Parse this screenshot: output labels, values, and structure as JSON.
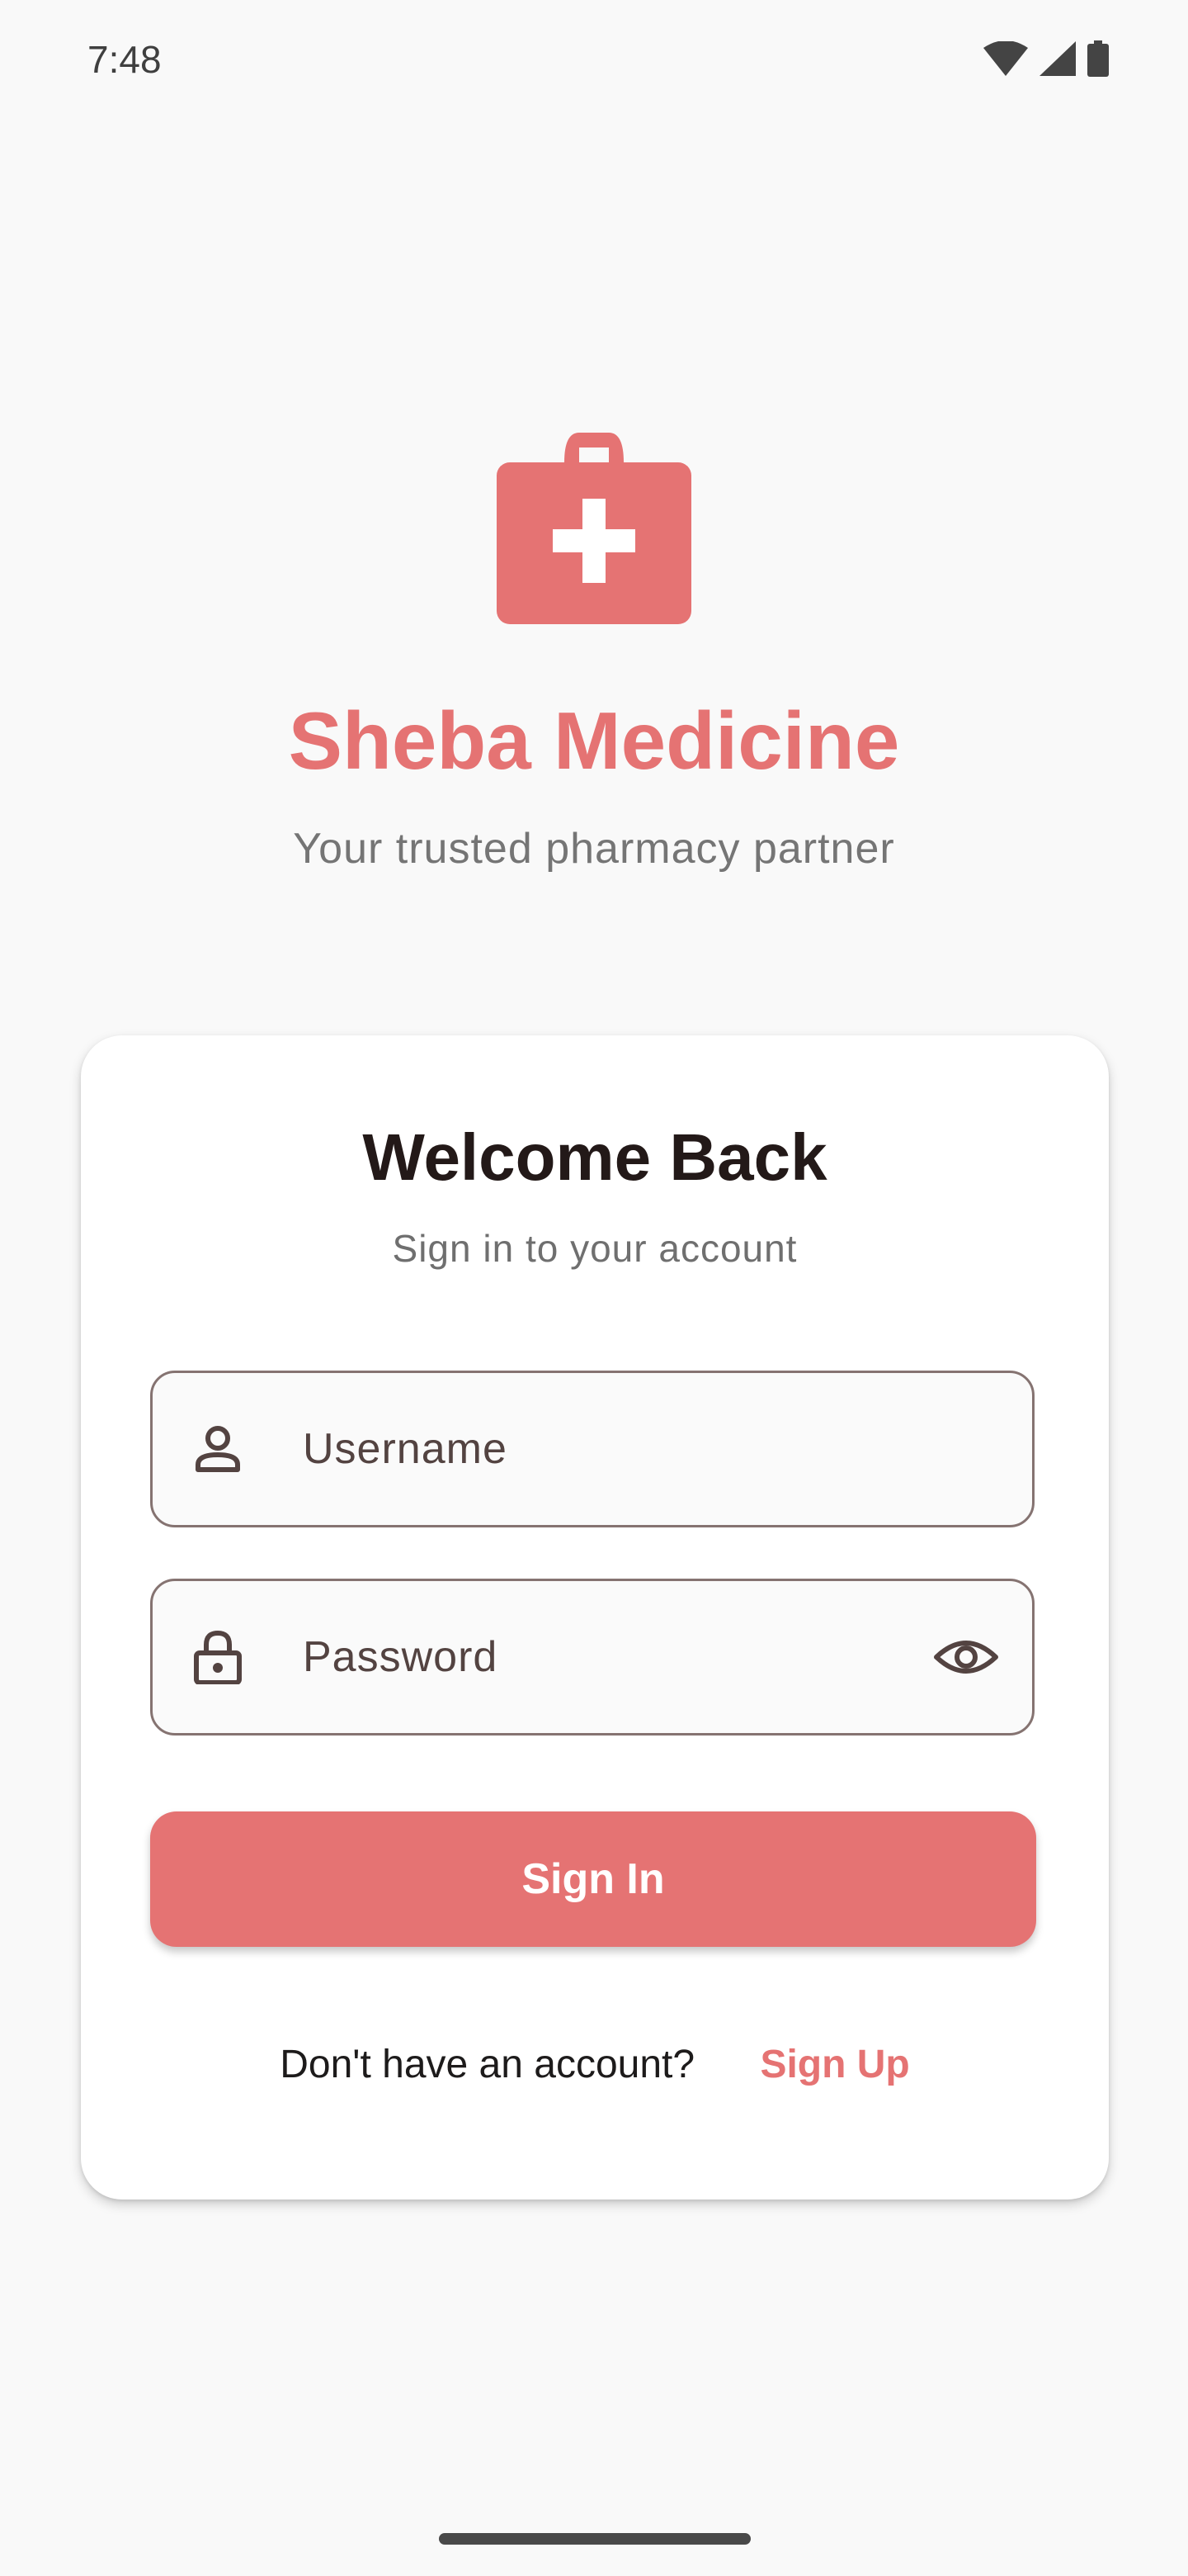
{
  "status_bar": {
    "time": "7:48",
    "icons": [
      "wifi-icon",
      "signal-icon",
      "battery-icon"
    ]
  },
  "brand": {
    "logo_icon": "medical-kit-icon",
    "title": "Sheba Medicine",
    "tagline": "Your trusted pharmacy partner",
    "accent_color": "#e57373"
  },
  "login_card": {
    "title": "Welcome Back",
    "subtitle": "Sign in to your account",
    "username": {
      "placeholder": "Username",
      "value": "",
      "icon": "person-icon"
    },
    "password": {
      "placeholder": "Password",
      "value": "",
      "icon": "lock-icon",
      "toggle_icon": "eye-icon"
    },
    "signin_label": "Sign In",
    "signup_prompt": "Don't have an account?",
    "signup_link": "Sign Up"
  }
}
